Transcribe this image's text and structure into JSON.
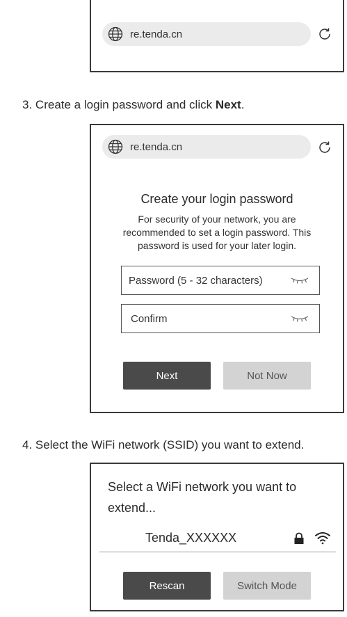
{
  "panel1": {
    "url": "re.tenda.cn"
  },
  "step3": {
    "number": "3.",
    "text_before": "Create a login password and click ",
    "text_bold": "Next",
    "text_after": "."
  },
  "panel2": {
    "url": "re.tenda.cn",
    "title": "Create your login password",
    "description": "For security of your network, you are recommended to set a login password. This password is used for your later login.",
    "password_placeholder": "Password (5 - 32 characters)",
    "confirm_placeholder": "Confirm",
    "next_label": "Next",
    "not_now_label": "Not Now"
  },
  "step4": {
    "number": "4.",
    "text": "Select the WiFi network (SSID) you want to extend."
  },
  "panel3": {
    "heading": "Select a WiFi network you want to extend...",
    "ssid": "Tenda_XXXXXX",
    "rescan_label": "Rescan",
    "switch_mode_label": "Switch Mode"
  },
  "colors": {
    "dark_button": "#4a4a4a",
    "light_button": "#d3d3d3",
    "url_bar": "#ebebeb"
  }
}
